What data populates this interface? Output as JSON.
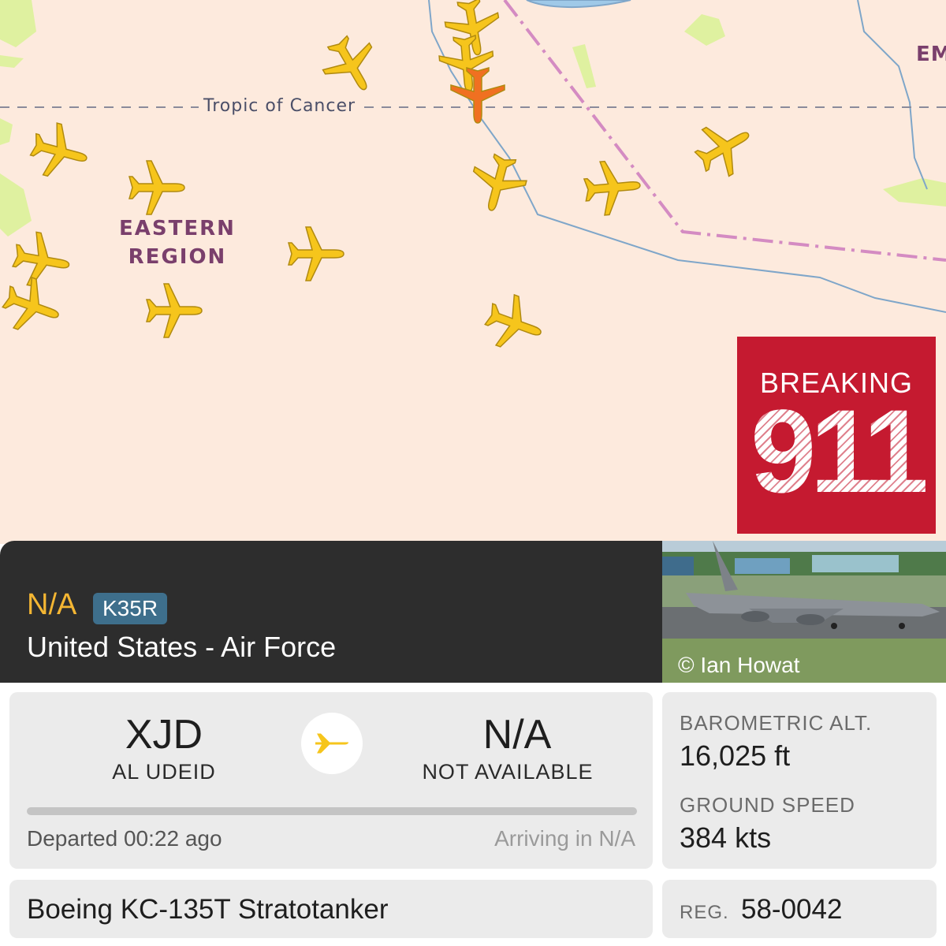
{
  "map": {
    "tropic_label": "Tropic of Cancer",
    "region_label_line1": "EASTERN",
    "region_label_line2": "REGION",
    "edge_label": "EM",
    "colors": {
      "land": "#fdeadd",
      "plane_default": "#f6c51c",
      "plane_selected": "#f07021",
      "border_dashdot": "#d48bc2",
      "border_thin": "#7fa6c9",
      "water": "#9fc9e8",
      "vegetation": "#dff1a0"
    },
    "aircraft": [
      {
        "name": "aircraft-marker",
        "state": "default"
      },
      {
        "name": "aircraft-marker",
        "state": "default"
      },
      {
        "name": "aircraft-marker",
        "state": "default"
      },
      {
        "name": "aircraft-marker",
        "state": "selected"
      },
      {
        "name": "aircraft-marker",
        "state": "default"
      },
      {
        "name": "aircraft-marker",
        "state": "default"
      },
      {
        "name": "aircraft-marker",
        "state": "default"
      },
      {
        "name": "aircraft-marker",
        "state": "default"
      },
      {
        "name": "aircraft-marker",
        "state": "default"
      },
      {
        "name": "aircraft-marker",
        "state": "default"
      },
      {
        "name": "aircraft-marker",
        "state": "default"
      },
      {
        "name": "aircraft-marker",
        "state": "default"
      },
      {
        "name": "aircraft-marker",
        "state": "default"
      },
      {
        "name": "aircraft-marker",
        "state": "default"
      },
      {
        "name": "aircraft-marker",
        "state": "default"
      }
    ]
  },
  "watermark": {
    "word": "BREAKING",
    "number": "911",
    "color": "#c51a30"
  },
  "flight": {
    "callsign": "N/A",
    "aircraft_type_code": "K35R",
    "operator": "United States - Air Force",
    "photo_credit": "© Ian Howat",
    "origin": {
      "code": "XJD",
      "name": "AL UDEID"
    },
    "destination": {
      "code": "N/A",
      "name": "NOT AVAILABLE"
    },
    "route_icon": "airplane-icon",
    "progress_percent": 0,
    "departed_text": "Departed 00:22 ago",
    "arriving_text": "Arriving in N/A",
    "barometric_alt_label": "BAROMETRIC ALT.",
    "barometric_alt_value": "16,025 ft",
    "ground_speed_label": "GROUND SPEED",
    "ground_speed_value": "384 kts",
    "aircraft_name": "Boeing KC-135T Stratotanker",
    "reg_label": "REG.",
    "reg_value": "58-0042"
  }
}
